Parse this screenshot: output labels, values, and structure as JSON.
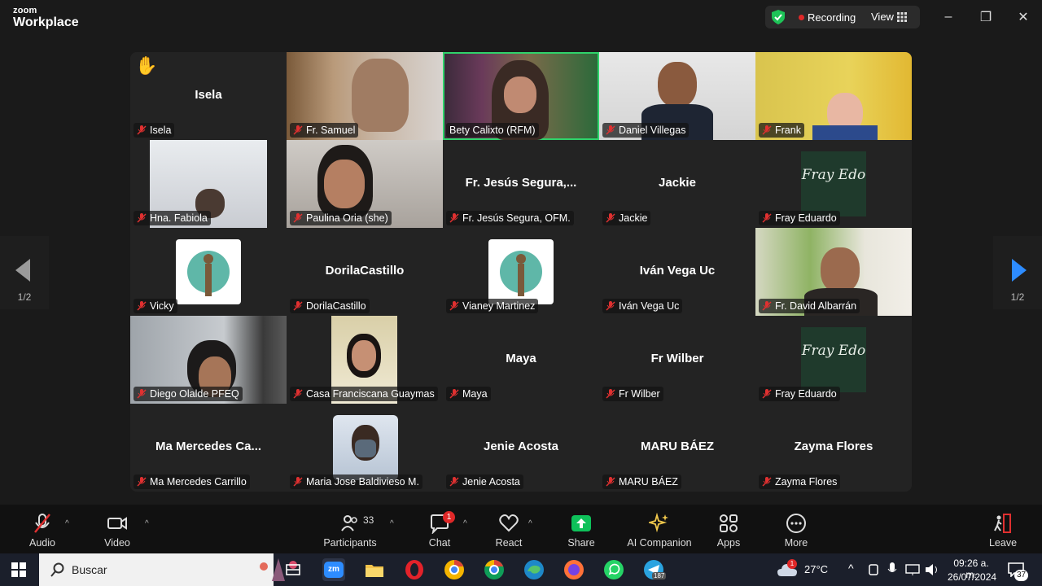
{
  "app": {
    "brand_top": "zoom",
    "brand_bottom": "Workplace"
  },
  "header": {
    "recording_label": "Recording",
    "view_label": "View"
  },
  "colors": {
    "active_border": "#2fd36b",
    "record_red": "#e02828",
    "shield_green": "#1ec458",
    "share_green": "#0ec15a"
  },
  "participants": [
    {
      "name": "Isela",
      "display": "Isela",
      "hand": "✋"
    },
    {
      "name": "Fr. Samuel"
    },
    {
      "name": "Bety Calixto (RFM)"
    },
    {
      "name": "Daniel Villegas"
    },
    {
      "name": "Frank"
    },
    {
      "name": "Hna. Fabiola"
    },
    {
      "name": "Paulina Oria (she)"
    },
    {
      "name": "Fr. Jesús Segura, OFM.",
      "display": "Fr. Jesús Segura,..."
    },
    {
      "name": "Jackie",
      "display": "Jackie"
    },
    {
      "name": "Fray Eduardo",
      "logo": "Fray Edo"
    },
    {
      "name": "Vicky"
    },
    {
      "name": "DorilaCastillo",
      "display": "DorilaCastillo"
    },
    {
      "name": "Vianey Martinez"
    },
    {
      "name": "Iván Vega Uc",
      "display": "Iván Vega Uc"
    },
    {
      "name": "Fr. David Albarrán"
    },
    {
      "name": "Diego Olalde PFEQ"
    },
    {
      "name": "Casa Franciscana Guaymas"
    },
    {
      "name": "Maya",
      "display": "Maya"
    },
    {
      "name": "Fr Wilber",
      "display": "Fr Wilber"
    },
    {
      "name": "Fray Eduardo",
      "logo": "Fray Edo"
    },
    {
      "name": "Ma Mercedes Carrillo",
      "display": "Ma  Mercedes  Ca..."
    },
    {
      "name": "Maria Jose Baldivieso M."
    },
    {
      "name": "Jenie Acosta",
      "display": "Jenie Acosta"
    },
    {
      "name": "MARU BÁEZ",
      "display": "MARU BÁEZ"
    },
    {
      "name": "Zayma Flores",
      "display": "Zayma Flores"
    }
  ],
  "pagination": {
    "left": "1/2",
    "right": "1/2"
  },
  "toolbar": {
    "audio": "Audio",
    "video": "Video",
    "participants": "Participants",
    "participants_count": "33",
    "chat": "Chat",
    "chat_badge": "1",
    "react": "React",
    "share": "Share",
    "ai": "AI Companion",
    "apps": "Apps",
    "more": "More",
    "leave": "Leave"
  },
  "taskbar": {
    "search_placeholder": "Buscar",
    "weather": "27°C",
    "weather_badge": "1",
    "time": "09:26 a. m.",
    "date": "26/07/2024",
    "notif_count": "37",
    "telegram_badge": "187"
  }
}
